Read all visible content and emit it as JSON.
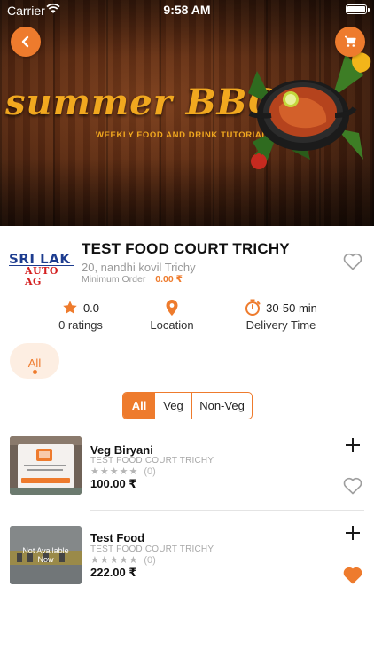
{
  "status_bar": {
    "carrier": "Carrier",
    "time": "9:58 AM"
  },
  "banner": {
    "title": "summer BBQ",
    "subtitle": "WEEKLY FOOD AND DRINK TUTORIALS"
  },
  "restaurant": {
    "logo_line1": "SRI LAK",
    "logo_line2": "AUTO AG",
    "name": "TEST FOOD COURT TRICHY",
    "address": "20, nandhi kovil Trichy",
    "min_order_label": "Minimum Order",
    "min_order_value": "0.00 ₹",
    "favorite": false
  },
  "stats": {
    "rating_value": "0.0",
    "rating_label": "0 ratings",
    "location_label": "Location",
    "delivery_time": "30-50 min",
    "delivery_label": "Delivery Time"
  },
  "categories": [
    {
      "label": "All",
      "selected": true
    }
  ],
  "filter": {
    "options": [
      "All",
      "Veg",
      "Non-Veg"
    ],
    "selected": "All"
  },
  "items": [
    {
      "name": "Veg Biryani",
      "restaurant": "TEST FOOD COURT TRICHY",
      "rating_count": "(0)",
      "price": "100.00 ₹",
      "favorite": false,
      "available": true
    },
    {
      "name": "Test Food",
      "restaurant": "TEST FOOD COURT TRICHY",
      "rating_count": "(0)",
      "price": "222.00 ₹",
      "favorite": true,
      "available": false,
      "overlay_text": "Not Available Now"
    }
  ],
  "colors": {
    "accent": "#ee7b2d",
    "accent_light": "#fdeee2",
    "muted": "#a8a8a8"
  },
  "icons": [
    "back-arrow-icon",
    "cart-icon",
    "star-icon",
    "location-pin-icon",
    "stopwatch-icon",
    "heart-icon",
    "plus-icon",
    "wifi-icon",
    "battery-icon"
  ]
}
